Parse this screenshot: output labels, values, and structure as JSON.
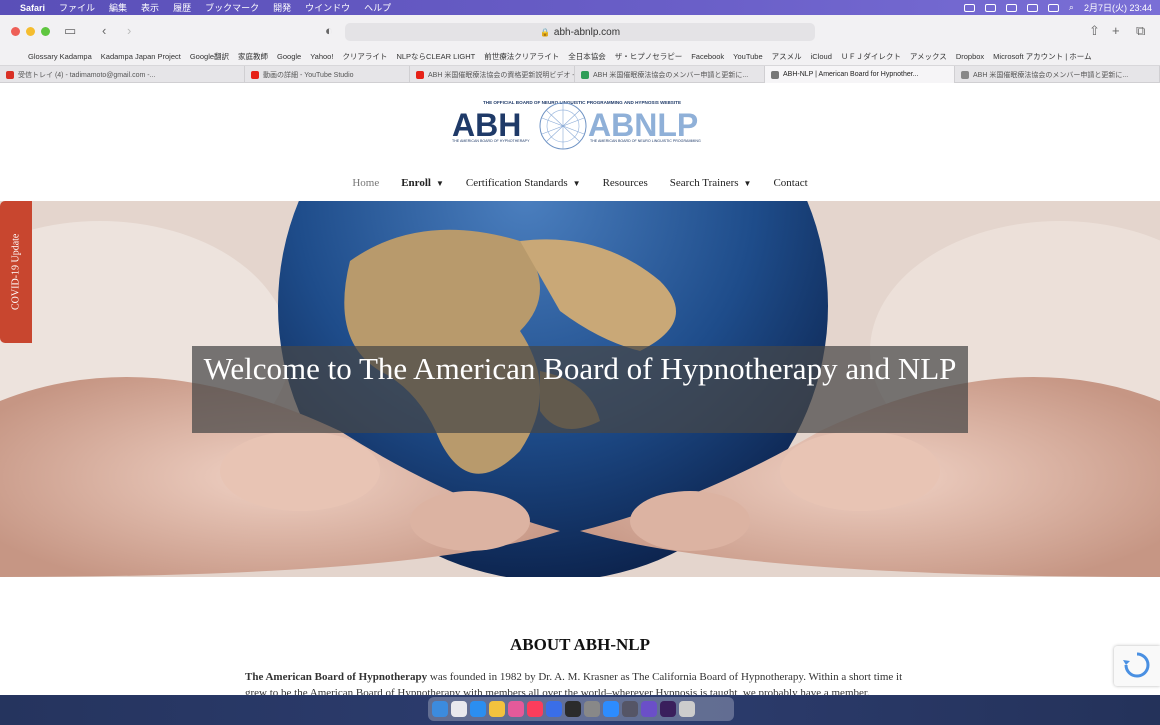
{
  "menubar": {
    "items": [
      "Safari",
      "ファイル",
      "編集",
      "表示",
      "履歴",
      "ブックマーク",
      "開発",
      "ウインドウ",
      "ヘルプ"
    ],
    "clock": "2月7日(火)  23:44"
  },
  "browser": {
    "url": "abh-abnlp.com",
    "bookmarks": [
      "Glossary Kadampa",
      "Kadampa Japan Project",
      "Google翻訳",
      "家庭教師",
      "Google",
      "Yahoo!",
      "クリアライト",
      "NLPならCLEAR LIGHT",
      "前世療法クリアライト",
      "全日本協会",
      "ザ・ヒプノセラピー",
      "Facebook",
      "YouTube",
      "アスメル",
      "iCloud",
      "ＵＦＪダイレクト",
      "アメックス",
      "Dropbox",
      "Microsoft アカウント | ホーム"
    ],
    "tabs": [
      {
        "label": "受信トレイ (4) - tadimamoto@gmail.com -...",
        "color": "#d93025"
      },
      {
        "label": "動画の詳細 - YouTube Studio",
        "color": "#e62117"
      },
      {
        "label": "ABH 米国催眠療法協会の資格更新説明ビデオ -...",
        "color": "#e62117"
      },
      {
        "label": "ABH 米国催眠療法協会のメンバー申請と更新に...",
        "color": "#2e9d57"
      },
      {
        "label": "ABH-NLP | American Board for Hypnother...",
        "color": "#777"
      },
      {
        "label": "ABH 米国催眠療法協会のメンバー申請と更新に...",
        "color": "#888"
      }
    ]
  },
  "logo": {
    "top_text": "THE OFFICIAL BOARD OF NEURO LINGUISTIC PROGRAMMING AND HYPNOSIS WEBSITE",
    "left": "ABH",
    "right": "ABNLP",
    "left_sub": "THE AMERICAN BOARD OF HYPNOTHERAPY",
    "right_sub": "THE AMERICAN BOARD OF NEURO LINGUISTIC PROGRAMMING"
  },
  "nav": {
    "home": "Home",
    "enroll": "Enroll",
    "certification": "Certification Standards",
    "resources": "Resources",
    "search_trainers": "Search Trainers",
    "contact": "Contact"
  },
  "covid_tab": "COVID-19 Update",
  "hero": {
    "title": "Welcome to The American Board of Hypnotherapy and NLP"
  },
  "about": {
    "heading": "ABOUT ABH-NLP",
    "bold": "The American Board of Hypnotherapy",
    "text": " was founded in 1982 by Dr. A. M. Krasner as The California Board of Hypnotherapy. Within a short time it grew to be the American Board of Hypnotherapy with members all over the world–wherever Hypnosis is taught, we probably have a member."
  },
  "colors": {
    "brand_dark": "#1f3a68",
    "brand_light": "#8fb0d8",
    "covid_tab": "#c8462f",
    "menubar": "#5a4fb8"
  }
}
